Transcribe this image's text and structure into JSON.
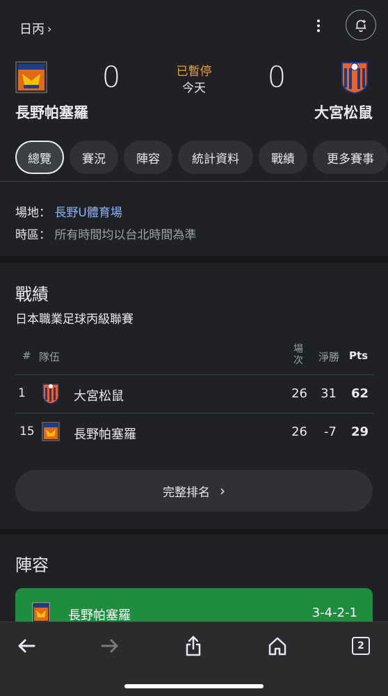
{
  "header": {
    "league_link": "日丙"
  },
  "match": {
    "home": {
      "name": "長野帕塞羅",
      "score": "0"
    },
    "away": {
      "name": "大宮松鼠",
      "score": "0"
    },
    "status": "已暫停",
    "date": "今天"
  },
  "tabs": [
    "總覽",
    "賽況",
    "陣容",
    "統計資料",
    "戰績",
    "更多賽事"
  ],
  "info": {
    "venue_label": "場地：",
    "venue_value": "長野U體育場",
    "timezone_label": "時區：",
    "timezone_value": "所有時間均以台北時間為準"
  },
  "standings": {
    "title": "戰績",
    "league": "日本職業足球丙級聯賽",
    "headers": {
      "rank": "#",
      "team": "隊伍",
      "played": "場次",
      "gd": "淨勝",
      "pts": "Pts"
    },
    "rows": [
      {
        "rank": "1",
        "team": "大宮松鼠",
        "played": "26",
        "gd": "31",
        "pts": "62"
      },
      {
        "rank": "15",
        "team": "長野帕塞羅",
        "played": "26",
        "gd": "-7",
        "pts": "29"
      }
    ],
    "full_button": "完整排名"
  },
  "lineup": {
    "title": "陣容",
    "team": "長野帕塞羅",
    "formation": "3-4-2-1"
  },
  "toolbar": {
    "tab_count": "2"
  },
  "colors": {
    "accent_status": "#e2a33c",
    "link": "#8ab4f8",
    "lineup_green": "#1e8e3e",
    "background": "#202124"
  }
}
